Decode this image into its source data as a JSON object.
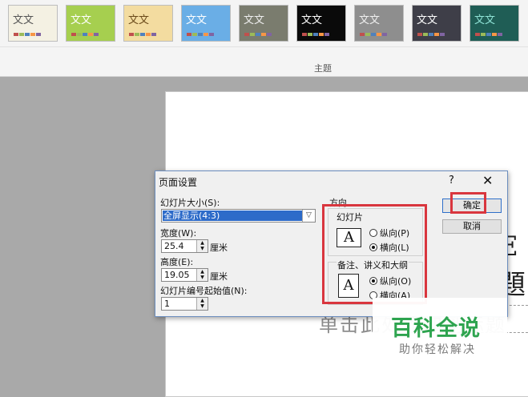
{
  "ribbon": {
    "group_label": "主题",
    "themes": [
      {
        "text": "文文",
        "bg": "#f4f1e3",
        "fg": "#555555"
      },
      {
        "text": "文文",
        "bg": "#a6cf4f",
        "fg": "#ffffff"
      },
      {
        "text": "文文",
        "bg": "#f3dca0",
        "fg": "#6a4a1a"
      },
      {
        "text": "文文",
        "bg": "#6aaee6",
        "fg": "#ffffff"
      },
      {
        "text": "文文",
        "bg": "#7a7c6e",
        "fg": "#eeeeee"
      },
      {
        "text": "文文",
        "bg": "#0a0a0a",
        "fg": "#ffffff"
      },
      {
        "text": "文文",
        "bg": "#8e8e8e",
        "fg": "#f0f0f0"
      },
      {
        "text": "文文",
        "bg": "#3e3e48",
        "fg": "#ffffff"
      },
      {
        "text": "文文",
        "bg": "#1f5d55",
        "fg": "#8fe3d6"
      }
    ]
  },
  "slide": {
    "title_fragment": "E題",
    "subtitle": "单击此处添加副标题"
  },
  "dialog": {
    "title": "页面设置",
    "help": "?",
    "close": "✕",
    "size_label": "幻灯片大小(S):",
    "size_value": "全屏显示(4:3)",
    "width_label": "宽度(W):",
    "width_value": "25.4",
    "height_label": "高度(E):",
    "height_value": "19.05",
    "unit": "厘米",
    "start_label": "幻灯片编号起始值(N):",
    "start_value": "1",
    "orientation_label": "方向",
    "slides_group": "幻灯片",
    "notes_group": "备注、讲义和大纲",
    "portrait_label": "纵向(P)",
    "landscape_label": "横向(L)",
    "notes_portrait_label": "纵向(O)",
    "notes_landscape_label": "横向(A)",
    "ok": "确定",
    "cancel": "取消"
  },
  "watermark": {
    "title": "百科全说",
    "subtitle": "助你轻松解决"
  },
  "colors": {
    "accent": "#2d6bc9",
    "highlight": "#d9363e",
    "watermark": "#2ea44f"
  }
}
